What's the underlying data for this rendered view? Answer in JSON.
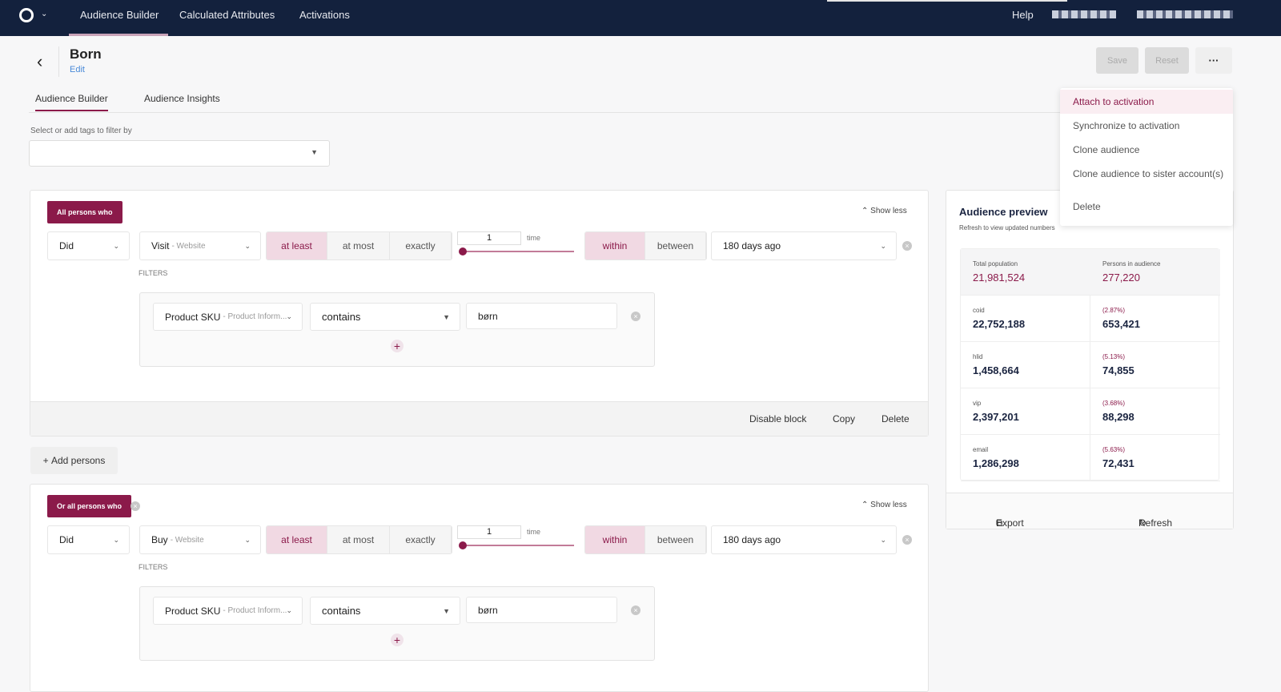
{
  "nav": {
    "items": [
      "Audience Builder",
      "Calculated Attributes",
      "Activations"
    ],
    "help": "Help"
  },
  "header": {
    "title": "Born",
    "edit": "Edit",
    "save": "Save",
    "reset": "Reset",
    "more": "···"
  },
  "tabs": [
    "Audience Builder",
    "Audience Insights"
  ],
  "tags": {
    "label": "Select or add tags to filter by",
    "value": ""
  },
  "blocks": [
    {
      "badge": "All persons who",
      "show_less": "Show less",
      "did": "Did",
      "event": "Visit",
      "event_source": "- Website",
      "freq": [
        "at least",
        "at most",
        "exactly"
      ],
      "freq_selected": 0,
      "count": "1",
      "count_unit": "time",
      "range": [
        "within",
        "between"
      ],
      "range_selected": 0,
      "period": "180 days ago",
      "filters_label": "FILTERS",
      "filter": {
        "field": "Product SKU",
        "source": "- Product Inform...",
        "op": "contains",
        "value": "børn"
      },
      "footer": [
        "Disable block",
        "Copy",
        "Delete"
      ]
    },
    {
      "badge": "Or all persons who",
      "show_less": "Show less",
      "did": "Did",
      "event": "Buy",
      "event_source": "- Website",
      "freq": [
        "at least",
        "at most",
        "exactly"
      ],
      "freq_selected": 0,
      "count": "1",
      "count_unit": "time",
      "range": [
        "within",
        "between"
      ],
      "range_selected": 0,
      "period": "180 days ago",
      "filters_label": "FILTERS",
      "filter": {
        "field": "Product SKU",
        "source": "- Product Inform...",
        "op": "contains",
        "value": "børn"
      }
    }
  ],
  "add_persons": "Add persons",
  "preview": {
    "title": "Audience preview",
    "subtitle": "Refresh to view updated numbers",
    "total_label": "Total population",
    "total": "21,981,524",
    "persons_label": "Persons in audience",
    "persons": "277,220",
    "rows": [
      {
        "label": "coid",
        "total": "22,752,188",
        "pct": "(2.87%)",
        "count": "653,421"
      },
      {
        "label": "hlid",
        "total": "1,458,664",
        "pct": "(5.13%)",
        "count": "74,855"
      },
      {
        "label": "vip",
        "total": "2,397,201",
        "pct": "(3.68%)",
        "count": "88,298"
      },
      {
        "label": "email",
        "total": "1,286,298",
        "pct": "(5.63%)",
        "count": "72,431"
      }
    ],
    "export": "Export",
    "refresh": "Refresh"
  },
  "menu": {
    "items": [
      "Attach to activation",
      "Synchronize to activation",
      "Clone audience",
      "Clone audience to sister account(s)",
      "Delete"
    ],
    "highlighted": 0
  },
  "colors": {
    "accent": "#8b1a4a",
    "nav_bg": "#13213d"
  }
}
